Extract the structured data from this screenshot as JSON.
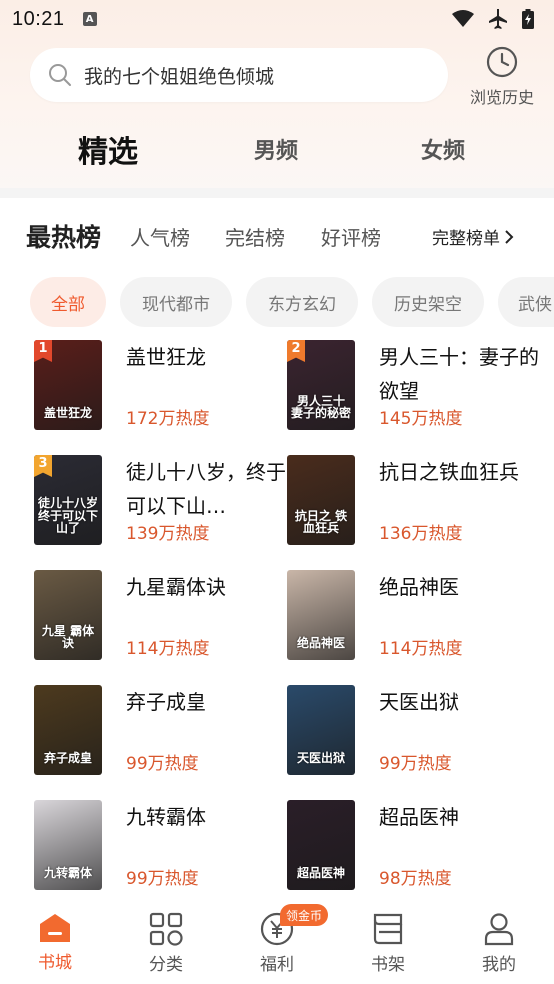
{
  "status_bar": {
    "time": "10:21",
    "notification_icon": "A"
  },
  "search": {
    "query": "我的七个姐姐绝色倾城"
  },
  "history": {
    "label": "浏览历史"
  },
  "top_tabs": [
    {
      "label": "精选",
      "active": true
    },
    {
      "label": "男频",
      "active": false
    },
    {
      "label": "女频",
      "active": false
    }
  ],
  "ranking": {
    "title": "最热榜",
    "tabs": [
      "人气榜",
      "完结榜",
      "好评榜"
    ],
    "full_list": "完整榜单"
  },
  "chips": [
    {
      "label": "全部",
      "active": true
    },
    {
      "label": "现代都市",
      "active": false
    },
    {
      "label": "东方玄幻",
      "active": false
    },
    {
      "label": "历史架空",
      "active": false
    },
    {
      "label": "武侠",
      "active": false
    }
  ],
  "books": [
    {
      "rank": "1",
      "title": "盖世狂龙",
      "heat": "172万热度",
      "cover_text": "盖世狂龙",
      "cover_color": "#5a1e1a"
    },
    {
      "rank": "2",
      "title": "男人三十：妻子的欲望",
      "heat": "145万热度",
      "cover_text": "男人三十 妻子的秘密",
      "cover_color": "#3b2430"
    },
    {
      "rank": "3",
      "title": "徒儿十八岁，终于可以下山…",
      "heat": "139万热度",
      "cover_text": "徒儿十八岁 终于可以下山了",
      "cover_color": "#2b2b34"
    },
    {
      "rank": "",
      "title": "抗日之铁血狂兵",
      "heat": "136万热度",
      "cover_text": "抗日之 铁血狂兵",
      "cover_color": "#4a2c1c"
    },
    {
      "rank": "",
      "title": "九星霸体诀",
      "heat": "114万热度",
      "cover_text": "九星 霸体诀",
      "cover_color": "#6a5a44"
    },
    {
      "rank": "",
      "title": "绝品神医",
      "heat": "114万热度",
      "cover_text": "绝品神医",
      "cover_color": "#c9b6a8"
    },
    {
      "rank": "",
      "title": "弃子成皇",
      "heat": "99万热度",
      "cover_text": "弃子成皇",
      "cover_color": "#4d3a1e"
    },
    {
      "rank": "",
      "title": "天医出狱",
      "heat": "99万热度",
      "cover_text": "天医出狱",
      "cover_color": "#2a4a6a"
    },
    {
      "rank": "",
      "title": "九转霸体",
      "heat": "99万热度",
      "cover_text": "九转霸体",
      "cover_color": "#d9d6da"
    },
    {
      "rank": "",
      "title": "超品医神",
      "heat": "98万热度",
      "cover_text": "超品医神",
      "cover_color": "#2a1e28"
    }
  ],
  "bottom_nav": [
    {
      "label": "书城",
      "icon": "bookstore-icon",
      "active": true
    },
    {
      "label": "分类",
      "icon": "category-icon",
      "active": false
    },
    {
      "label": "福利",
      "icon": "welfare-icon",
      "active": false
    },
    {
      "label": "书架",
      "icon": "bookshelf-icon",
      "active": false
    },
    {
      "label": "我的",
      "icon": "profile-icon",
      "active": false
    }
  ],
  "coin_badge": "领金币",
  "colors": {
    "accent": "#ef5a2e",
    "heat": "#d9572d"
  }
}
